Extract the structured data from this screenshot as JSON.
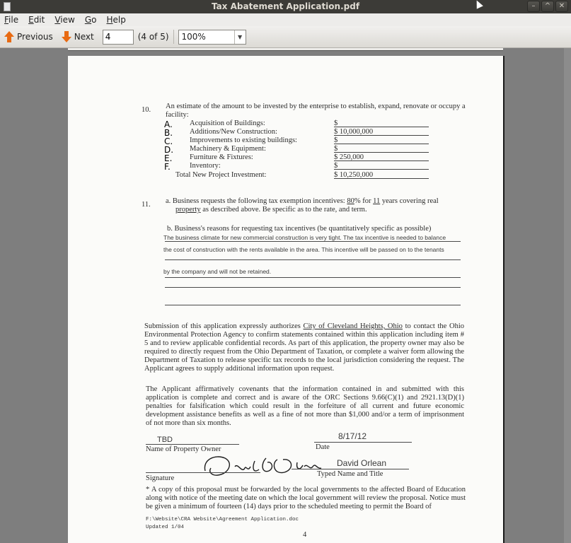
{
  "window": {
    "title": "Tax Abatement Application.pdf"
  },
  "menu": {
    "file": "File",
    "edit": "Edit",
    "view": "View",
    "go": "Go",
    "help": "Help",
    "file_mn": "F",
    "file_rest": "ile",
    "edit_mn": "E",
    "edit_rest": "dit",
    "view_mn": "V",
    "view_rest": "iew",
    "go_mn": "G",
    "go_rest": "o",
    "help_mn": "H",
    "help_rest": "elp"
  },
  "toolbar": {
    "previous_label": "Previous",
    "next_label": "Next",
    "page_value": "4",
    "page_count": "(4 of 5)",
    "zoom_value": "100%"
  },
  "icons": {
    "previous": "arrow-up-icon",
    "next": "arrow-down-icon",
    "dropdown": "chevron-down-icon",
    "accent": "#e86a12"
  },
  "document": {
    "q10": {
      "num": "10.",
      "line1": "An estimate of the amount to be invested by the enterprise to establish, expand, renovate or occupy a",
      "line2": "facility:",
      "rows": [
        {
          "letter": "A.",
          "label": "Acquisition of Buildings:",
          "amount": "$"
        },
        {
          "letter": "B.",
          "label": "Additions/New Construction:",
          "amount": "$ 10,000,000"
        },
        {
          "letter": "C.",
          "label": "Improvements to existing buildings:",
          "amount": "$"
        },
        {
          "letter": "D.",
          "label": "Machinery & Equipment:",
          "amount": "$"
        },
        {
          "letter": "E.",
          "label": "Furniture & Fixtures:",
          "amount": "$ 250,000"
        },
        {
          "letter": "F.",
          "label": "Inventory:",
          "amount": "$"
        }
      ],
      "total_label": "Total New Project Investment:",
      "total_amount": "$ 10,250,000"
    },
    "q11": {
      "num": "11.",
      "a_pre": "a. Business requests the following tax exemption incentives:",
      "a_percent": "80",
      "a_mid": "% for",
      "a_years": "11",
      "a_post": "years covering real",
      "a_line2_u": "property",
      "a_line2": " as described above.  Be specific as to the rate, and term.",
      "b_heading": "b. Business's reasons for requesting tax incentives (be quantitatively specific as possible)",
      "b_answer1": "The business climate for new commercial construction is very tight.  The tax incentive is needed to balance",
      "b_answer2": "the cost of construction with the rents available in the area.  This incentive will be passed on to the tenants",
      "b_answer3": "by the company and will not be retained."
    },
    "para1_pre": "Submission of this application expressly authorizes ",
    "para1_city": "City of Cleveland Heights, Ohio",
    "para1_post": " to contact the Ohio Environmental Protection Agency to confirm statements contained within this application including item # 5 and to review applicable confidential records. As part of this application, the property owner may also be required to directly request from the Ohio Department of Taxation, or complete a waiver form allowing the Department of Taxation to release specific tax records to the local jurisdiction considering the request. The Applicant agrees to supply additional information upon request.",
    "para2": "The Applicant affirmatively covenants that the information contained in and submitted with this application is complete and correct and is aware of the ORC Sections 9.66(C)(1) and 2921.13(D)(1) penalties for falsification which could result in the forfeiture of all current and future economic development assistance benefits as well as a fine of not more than $1,000 and/or a term of imprisonment of not more than six months.",
    "owner_value": "TBD",
    "owner_label": "Name of Property Owner",
    "date_value": "8/17/12",
    "date_label": "Date",
    "signature_label": "Signature",
    "typed_name_value": "David Orlean",
    "typed_name_label": "Typed Name and Title",
    "footnote": "* A copy of this proposal must be forwarded by the local governments to the affected Board of Education along with notice of the meeting date on which the local government will review the proposal. Notice must be given a minimum of fourteen (14) days prior to the scheduled meeting to permit the Board of",
    "file_path": "F:\\Website\\CRA Website\\Agreement Application.doc",
    "updated": "Updated 1/04",
    "page_number": "4"
  }
}
